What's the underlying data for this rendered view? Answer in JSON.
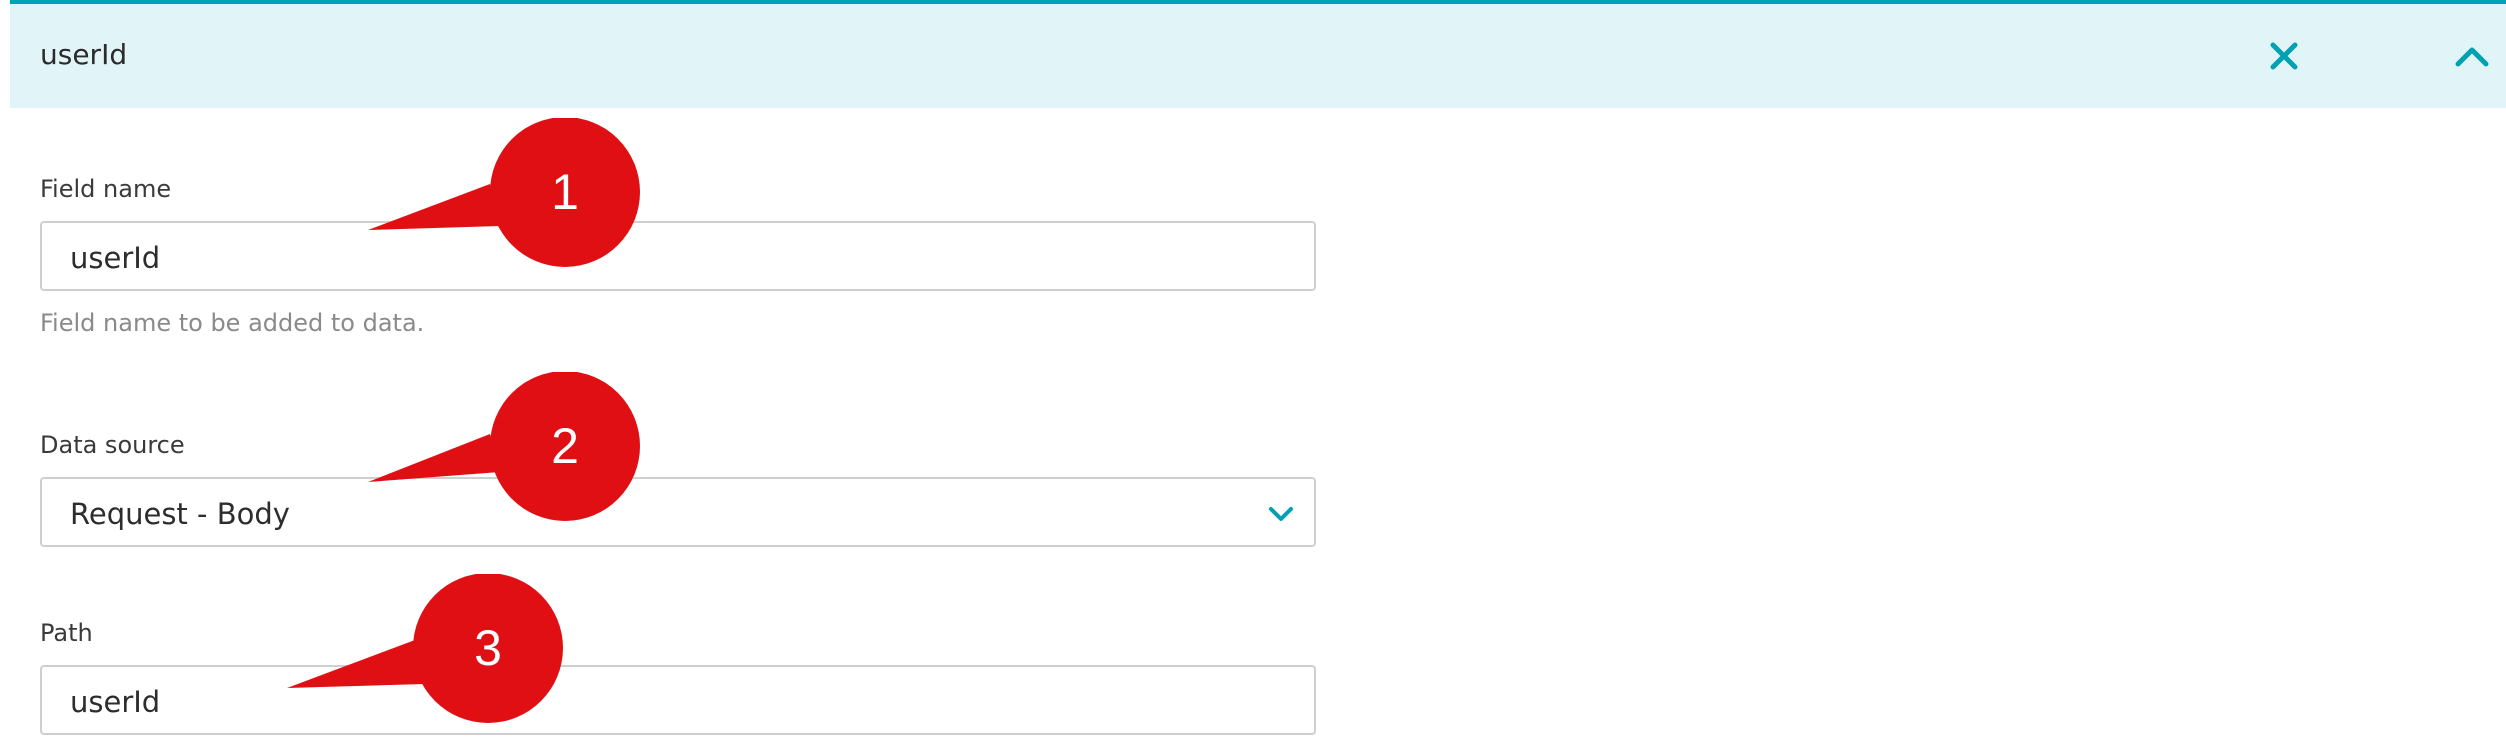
{
  "panel": {
    "title": "userId",
    "close_icon": "close-icon",
    "collapse_icon": "chevron-up-icon",
    "accent_color": "#00a1b2",
    "header_background": "#e1f5f8"
  },
  "fields": {
    "field_name": {
      "label": "Field name",
      "value": "userId",
      "hint": "Field name to be added to data."
    },
    "data_source": {
      "label": "Data source",
      "selected": "Request - Body",
      "chevron_icon": "chevron-down-icon"
    },
    "path": {
      "label": "Path",
      "value": "userId"
    }
  },
  "annotations": {
    "color": "#e00f13",
    "markers": [
      "1",
      "2",
      "3"
    ]
  }
}
